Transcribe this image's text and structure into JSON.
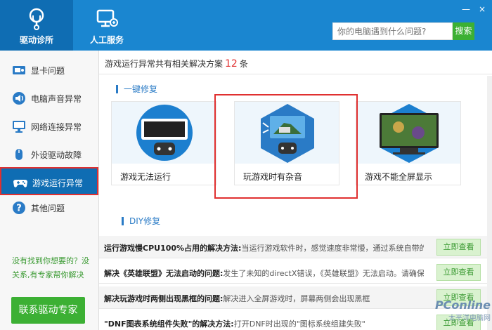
{
  "header": {
    "tabs": [
      {
        "label": "驱动诊所",
        "icon": "stethoscope-icon"
      },
      {
        "label": "人工服务",
        "icon": "support-icon"
      }
    ],
    "search": {
      "placeholder": "你的电脑遇到什么问题?",
      "button": "搜索"
    },
    "window_buttons": {
      "minimize": "—",
      "close": "×"
    }
  },
  "sidebar": {
    "items": [
      {
        "label": "显卡问题",
        "icon": "graphics-card-icon"
      },
      {
        "label": "电脑声音异常",
        "icon": "speaker-icon"
      },
      {
        "label": "网络连接异常",
        "icon": "monitor-icon"
      },
      {
        "label": "外设驱动故障",
        "icon": "mouse-icon"
      },
      {
        "label": "游戏运行异常",
        "icon": "gamepad-icon"
      },
      {
        "label": "其他问题",
        "icon": "question-icon"
      }
    ],
    "active_index": 4,
    "note": "没有找到你想要的？没关系,有专家帮你解决",
    "cta": "联系驱动专家"
  },
  "main": {
    "summary_prefix": "游戏运行异常共有相关解决方案",
    "summary_count": "12",
    "summary_suffix": "条",
    "section_one_click": "一键修复",
    "cards": [
      {
        "title": "游戏无法运行"
      },
      {
        "title": "玩游戏时有杂音"
      },
      {
        "title": "游戏不能全屏显示"
      }
    ],
    "section_diy": "DIY修复",
    "diy_rows": [
      {
        "title": "运行游戏慢CPU100%占用的解决方法:",
        "desc": "当运行游戏软件时，感觉速度非常慢，通过系统自带的任...",
        "button": "立即查看"
      },
      {
        "title": "解决《英雄联盟》无法启动的问题:",
        "desc": "发生了未知的directX错误，《英雄联盟》无法启动。请确保...",
        "button": "立即查看"
      },
      {
        "title": "解决玩游戏时两侧出现黑框的问题:",
        "desc": "解决进入全屏游戏时，屏幕两侧会出现黑框",
        "button": "立即查看"
      },
      {
        "title": "\"DNF图表系统组件失败\"的解决方法:",
        "desc": "打开DNF时出现的\"图标系统组建失败\"",
        "button": "立即查看"
      }
    ]
  },
  "watermark": {
    "line1": "PConline",
    "line2": "太平洋电脑网"
  },
  "colors": {
    "brand": "#1a86d0",
    "accent_green": "#3cb034",
    "highlight": "#e03030"
  }
}
